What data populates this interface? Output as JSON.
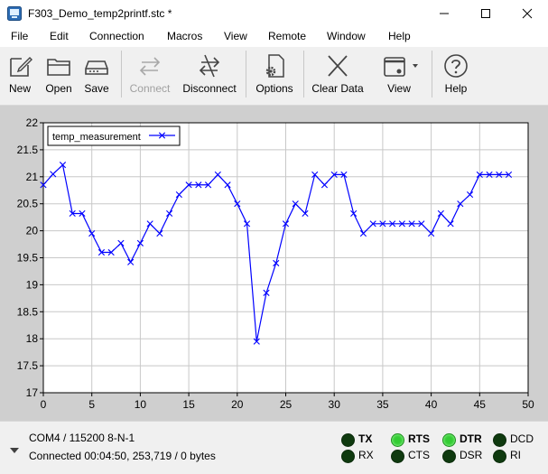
{
  "window": {
    "title": "F303_Demo_temp2printf.stc *",
    "controls": {
      "minimize": "—",
      "maximize": "☐",
      "close": "✕"
    }
  },
  "menu": [
    "File",
    "Edit",
    "Connection",
    "Macros",
    "View",
    "Remote",
    "Window",
    "Help"
  ],
  "toolbar": {
    "new": "New",
    "open": "Open",
    "save": "Save",
    "connect": "Connect",
    "disconnect": "Disconnect",
    "options": "Options",
    "clear_data": "Clear Data",
    "view": "View",
    "help": "Help"
  },
  "chart_data": {
    "type": "line",
    "xlim": [
      0,
      50
    ],
    "ylim": [
      17,
      22
    ],
    "xticks": [
      0,
      5,
      10,
      15,
      20,
      25,
      30,
      35,
      40,
      45,
      50
    ],
    "yticks": [
      17,
      17.5,
      18,
      18.5,
      19,
      19.5,
      20,
      20.5,
      21,
      21.5,
      22
    ],
    "grid": true,
    "legend_position": "top-left",
    "series": [
      {
        "name": "temp_measurement",
        "color": "#0000ff",
        "marker": "x",
        "x": [
          0,
          1,
          2,
          3,
          4,
          5,
          6,
          7,
          8,
          9,
          10,
          11,
          12,
          13,
          14,
          15,
          16,
          17,
          18,
          19,
          20,
          21,
          22,
          23,
          24,
          25,
          26,
          27,
          28,
          29,
          30,
          31,
          32,
          33,
          34,
          35,
          36,
          37,
          38,
          39,
          40,
          41,
          42,
          43,
          44,
          45,
          46,
          47,
          48
        ],
        "y": [
          20.85,
          21.05,
          21.22,
          20.32,
          20.32,
          19.95,
          19.6,
          19.6,
          19.77,
          19.42,
          19.77,
          20.13,
          19.95,
          20.32,
          20.67,
          20.85,
          20.85,
          20.85,
          21.04,
          20.85,
          20.5,
          20.13,
          17.95,
          18.85,
          19.4,
          20.13,
          20.5,
          20.32,
          21.04,
          20.85,
          21.04,
          21.04,
          20.32,
          19.95,
          20.13,
          20.13,
          20.13,
          20.13,
          20.13,
          20.13,
          19.95,
          20.32,
          20.13,
          20.5,
          20.67,
          21.04,
          21.04,
          21.04,
          21.04
        ]
      }
    ]
  },
  "status": {
    "connection": "COM4 / 115200 8-N-1",
    "details": "Connected 00:04:50, 253,719 / 0 bytes",
    "leds": [
      {
        "label": "TX",
        "on": false,
        "bold": true
      },
      {
        "label": "RX",
        "on": false,
        "bold": false
      },
      {
        "label": "RTS",
        "on": true,
        "bold": true
      },
      {
        "label": "CTS",
        "on": false,
        "bold": false
      },
      {
        "label": "DTR",
        "on": true,
        "bold": true
      },
      {
        "label": "DSR",
        "on": false,
        "bold": false
      },
      {
        "label": "DCD",
        "on": false,
        "bold": false
      },
      {
        "label": "RI",
        "on": false,
        "bold": false
      }
    ]
  }
}
